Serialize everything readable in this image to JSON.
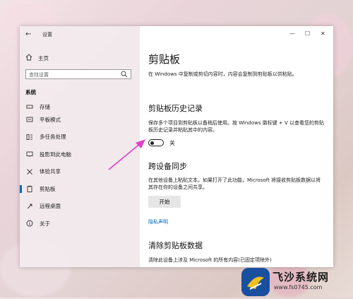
{
  "window": {
    "title": "设置",
    "back_glyph": "←",
    "controls": {
      "minimize": "—",
      "maximize": "☐",
      "close": "✕"
    }
  },
  "sidebar": {
    "home_label": "主页",
    "search_placeholder": "查找设置",
    "section_label": "系统",
    "items": [
      {
        "label": "存储",
        "icon": "storage-icon",
        "active": false
      },
      {
        "label": "平板模式",
        "icon": "tablet-icon",
        "active": false
      },
      {
        "label": "多任务处理",
        "icon": "multitask-icon",
        "active": false
      },
      {
        "label": "投影到此电脑",
        "icon": "project-icon",
        "active": false
      },
      {
        "label": "体验共享",
        "icon": "share-icon",
        "active": false
      },
      {
        "label": "剪贴板",
        "icon": "clipboard-icon",
        "active": true
      },
      {
        "label": "远程桌面",
        "icon": "remote-icon",
        "active": false
      },
      {
        "label": "关于",
        "icon": "info-icon",
        "active": false
      }
    ]
  },
  "main": {
    "title": "剪贴板",
    "intro": "在 Windows 中复制或剪切内容时，内容会复制到剪贴板以供粘贴。",
    "history": {
      "heading": "剪贴板历史记录",
      "desc": "保存多个项目到剪贴板以备稍后使用。按 Windows 徽标键 + V 以查看您的剪贴板历史记录并粘贴其中的内容。",
      "toggle_label": "关",
      "toggle_on": false
    },
    "sync": {
      "heading": "跨设备同步",
      "desc": "在其他设备上粘贴文本。如果打开了此功能，Microsoft 将接收剪贴板数据以将其存在你的设备之间共享。",
      "button_label": "开始",
      "link_label": "隐私声明"
    },
    "clear": {
      "heading": "清除剪贴板数据",
      "desc": "清除此设备上涉及 Microsoft 的所有内容(已固定项除外)"
    }
  },
  "watermark": {
    "brand": "飞沙系统网",
    "url": "www.fs0745.com"
  },
  "colors": {
    "accent": "#0067c0",
    "arrow": "#e040c8"
  }
}
